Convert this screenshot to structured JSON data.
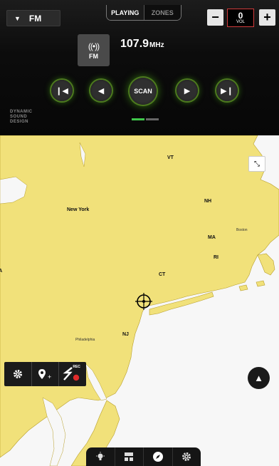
{
  "audio": {
    "source_label": "FM",
    "tabs": [
      "PLAYING",
      "ZONES"
    ],
    "volume": {
      "value": "0",
      "label": "VOL",
      "minus": "−",
      "plus": "+"
    },
    "band_label": "FM",
    "frequency": "107.9",
    "frequency_unit": "MHz",
    "scan_label": "SCAN",
    "brand_lines": [
      "DYNAMIC",
      "SOUND",
      "DESIGN"
    ],
    "page_indicator": {
      "count": 2,
      "active": 0
    }
  },
  "map": {
    "labels": {
      "vt": "VT",
      "nh": "NH",
      "new_york": "New York",
      "ma": "MA",
      "boston": "Boston",
      "ri": "RI",
      "pa": "PA",
      "ct": "CT",
      "nj": "NJ",
      "philadelphia": "Philadelphia"
    },
    "toolbar": {
      "rec_label": "REC"
    }
  },
  "colors": {
    "land": "#f1e17a",
    "water": "#f7f7f7",
    "accent": "#3fc64a",
    "vol_border": "#d23b3b"
  }
}
